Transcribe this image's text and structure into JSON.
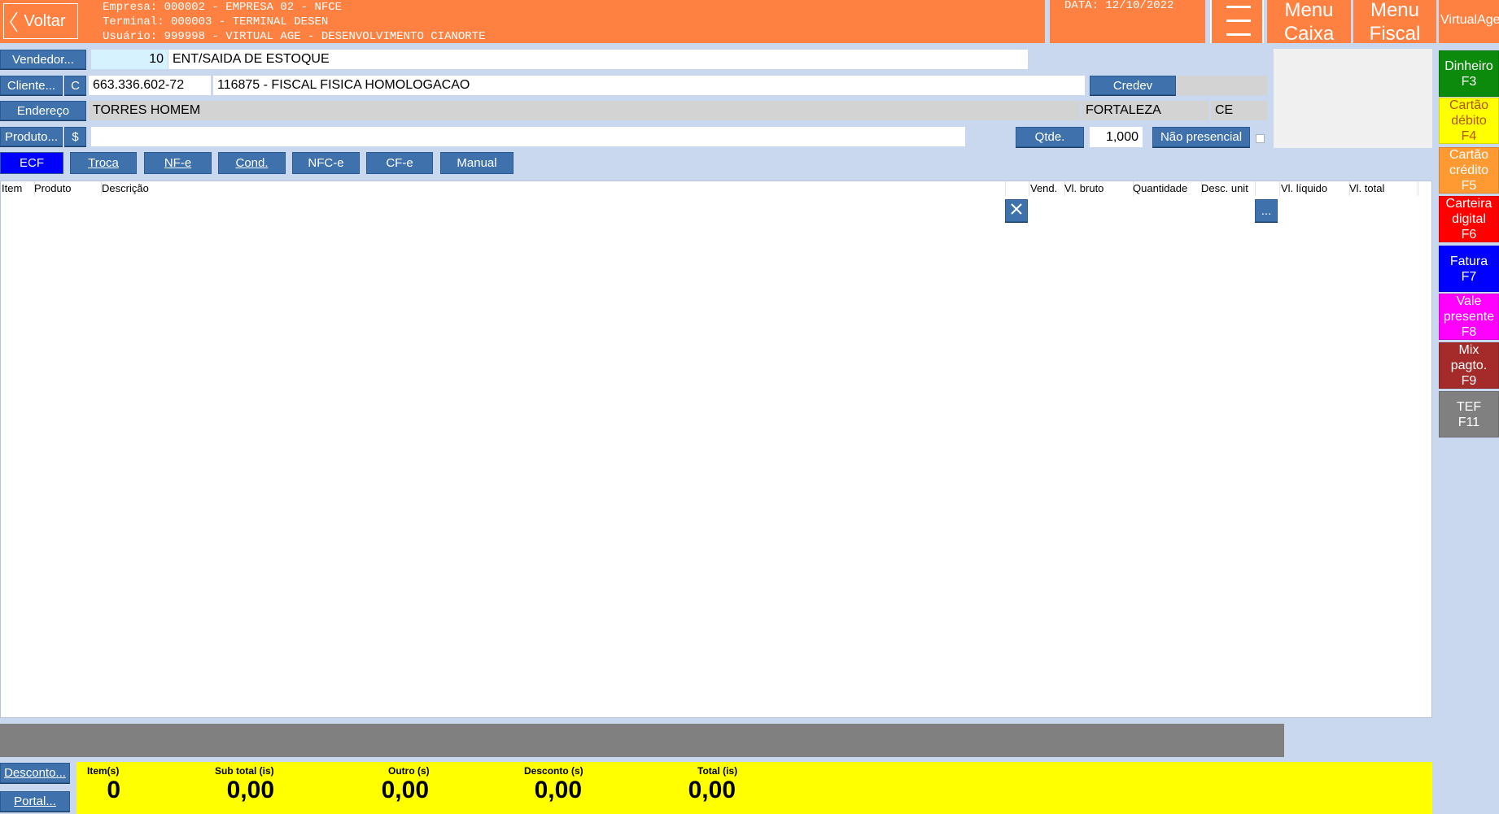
{
  "header": {
    "back_label": "Voltar",
    "empresa": "Empresa: 000002 - EMPRESA 02 - NFCE",
    "terminal": "Terminal: 000003 - TERMINAL DESEN",
    "usuario": "Usuário: 999998 - VIRTUAL AGE - DESENVOLVIMENTO CIANORTE",
    "date": "DATA: 12/10/2022",
    "menu_caixa_line1": "Menu",
    "menu_caixa_line2": "Caixa",
    "menu_fiscal_line1": "Menu",
    "menu_fiscal_line2": "Fiscal",
    "brand": "VirtualAge"
  },
  "form": {
    "vendedor_label": "Vendedor...",
    "vendedor_code": "10",
    "vendedor_desc": "ENT/SAIDA DE ESTOQUE",
    "cliente_label": "Cliente...",
    "cliente_c": "C",
    "cliente_doc": "663.336.602-72",
    "cliente_name": "116875 - FISCAL FISICA HOMOLOGACAO",
    "credev_label": "Credev",
    "endereco_label": "Endereço",
    "endereco_value": "TORRES HOMEM",
    "city": "FORTALEZA",
    "state": "CE",
    "produto_label": "Produto...",
    "produto_dollar": "$",
    "produto_value": "",
    "qtde_label": "Qtde.",
    "qtde_value": "1,000",
    "nao_presencial_label": "Não presencial"
  },
  "tabs": [
    {
      "label": "ECF",
      "active": true
    },
    {
      "label": "Troca",
      "active": false
    },
    {
      "label": "NF-e",
      "active": false
    },
    {
      "label": "Cond.",
      "active": false
    },
    {
      "label": "NFC-e",
      "active": false
    },
    {
      "label": "CF-e",
      "active": false
    },
    {
      "label": "Manual",
      "active": false
    }
  ],
  "grid": {
    "columns": [
      "Item",
      "Produto",
      "Descrição",
      "",
      "Vend.",
      "Vl. bruto",
      "Quantidade",
      "Desc. unit",
      "",
      "Vl. líquido",
      "Vl. total"
    ],
    "delete_icon": "close-icon",
    "more_label": "..."
  },
  "payments": [
    {
      "label": "Dinheiro\nF3",
      "color": "#0b8a0b",
      "text": "#ffffff"
    },
    {
      "label": "Cartão\ndébito\nF4",
      "color": "#ffff00",
      "text": "#b15500"
    },
    {
      "label": "Cartão\ncrédito\nF5",
      "color": "#ff9a33",
      "text": "#ffffff"
    },
    {
      "label": "Carteira\ndigital\nF6",
      "color": "#ff0000",
      "text": "#ffffff"
    },
    {
      "label": "Fatura\nF7",
      "color": "#0000ff",
      "text": "#ffffff"
    },
    {
      "label": "Vale\npresente\nF8",
      "color": "#ff00ff",
      "text": "#ffffff"
    },
    {
      "label": "Mix\npagto.\nF9",
      "color": "#a52a2a",
      "text": "#ffffff"
    },
    {
      "label": "TEF\nF11",
      "color": "#808080",
      "text": "#ffffff"
    }
  ],
  "footer": {
    "desconto_label": "Desconto...",
    "portal_label": "Portal...",
    "totals": [
      {
        "label": "Item(s)",
        "value": "0"
      },
      {
        "label": "Sub total (is)",
        "value": "0,00"
      },
      {
        "label": "Outro (s)",
        "value": "0,00"
      },
      {
        "label": "Desconto (s)",
        "value": "0,00"
      },
      {
        "label": "Total (is)",
        "value": "0,00"
      }
    ]
  }
}
